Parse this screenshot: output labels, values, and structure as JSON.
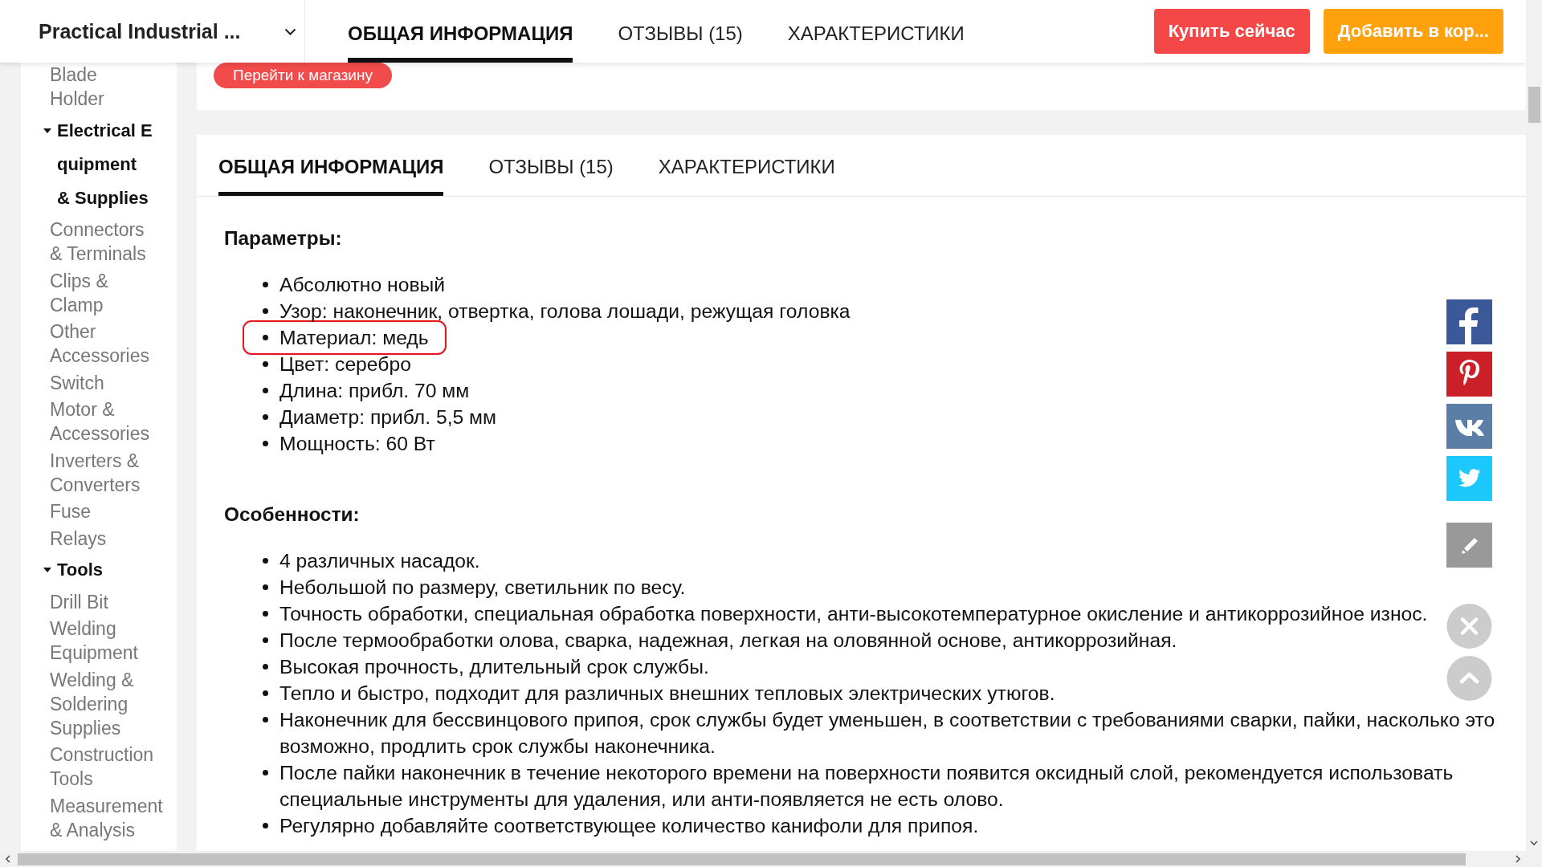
{
  "header": {
    "title": "Practical Industrial ...",
    "tabs": [
      {
        "label": "ОБЩАЯ ИНФОРМАЦИЯ",
        "selected": true
      },
      {
        "label": "ОТЗЫВЫ (15)",
        "selected": false
      },
      {
        "label": "ХАРАКТЕРИСТИКИ",
        "selected": false
      }
    ],
    "buttons": [
      {
        "label": "Купить сейчас",
        "kind": "buy"
      },
      {
        "label": "Добавить в кор...",
        "kind": "cart"
      }
    ]
  },
  "sidebar": {
    "items": [
      {
        "label": "Blade Holder"
      },
      {
        "label": "Electrical Equipment & Supplies",
        "expanded": true,
        "children": [
          {
            "label": "Connectors & Terminals"
          },
          {
            "label": "Clips & Clamp"
          },
          {
            "label": "Other Accessories"
          },
          {
            "label": "Switch"
          },
          {
            "label": "Motor & Accessories"
          },
          {
            "label": "Inverters & Converters"
          },
          {
            "label": "Fuse"
          },
          {
            "label": "Relays"
          }
        ]
      },
      {
        "label": "Tools",
        "expanded": true,
        "children": [
          {
            "label": "Drill Bit"
          },
          {
            "label": "Welding Equipment"
          },
          {
            "label": "Welding & Soldering Supplies"
          },
          {
            "label": "Construction Tools"
          },
          {
            "label": "Measurement & Analysis"
          }
        ]
      }
    ]
  },
  "store_card": {
    "button": "Перейти к магазину"
  },
  "details": {
    "tabs": [
      {
        "label": "ОБЩАЯ ИНФОРМАЦИЯ",
        "selected": true
      },
      {
        "label": "ОТЗЫВЫ (15)",
        "selected": false
      },
      {
        "label": "ХАРАКТЕРИСТИКИ",
        "selected": false
      }
    ],
    "sections": [
      {
        "heading": "Параметры:",
        "items": [
          {
            "text": "Абсолютно новый",
            "highlighted": false
          },
          {
            "text": "Узор: наконечник, отвертка, голова лошади, режущая головка",
            "highlighted": false
          },
          {
            "text": "Материал: медь",
            "highlighted": true
          },
          {
            "text": "Цвет: серебро",
            "highlighted": false
          },
          {
            "text": "Длина: прибл. 70 мм",
            "highlighted": false
          },
          {
            "text": "Диаметр: прибл. 5,5 мм",
            "highlighted": false
          },
          {
            "text": "Мощность: 60 Вт",
            "highlighted": false
          }
        ]
      },
      {
        "heading": "Особенности:",
        "items": [
          {
            "text": "4 различных насадок.",
            "highlighted": false
          },
          {
            "text": "Небольшой по размеру, светильник по весу.",
            "highlighted": false
          },
          {
            "text": "Точность обработки, специальная обработка поверхности, анти-высокотемпературное окисление и антикоррозийное износ.",
            "highlighted": false
          },
          {
            "text": "После термообработки олова, сварка, надежная, легкая на оловянной основе, антикоррозийная.",
            "highlighted": false
          },
          {
            "text": "Высокая прочность, длительный срок службы.",
            "highlighted": false
          },
          {
            "text": "Тепло и быстро, подходит для различных внешних тепловых электрических утюгов.",
            "highlighted": false
          },
          {
            "text": "Наконечник для бессвинцового припоя, срок службы будет уменьшен, в соответствии с требованиями сварки, пайки, насколько это возможно, продлить срок службы наконечника.",
            "highlighted": false
          },
          {
            "text": "После пайки наконечник в течение некоторого времени на поверхности появится оксидный слой, рекомендуется использовать специальные инструменты для удаления, или анти-появляется не есть олово.",
            "highlighted": false
          },
          {
            "text": "Регулярно добавляйте соответствующее количество канифоли для припоя.",
            "highlighted": false
          }
        ]
      }
    ]
  }
}
